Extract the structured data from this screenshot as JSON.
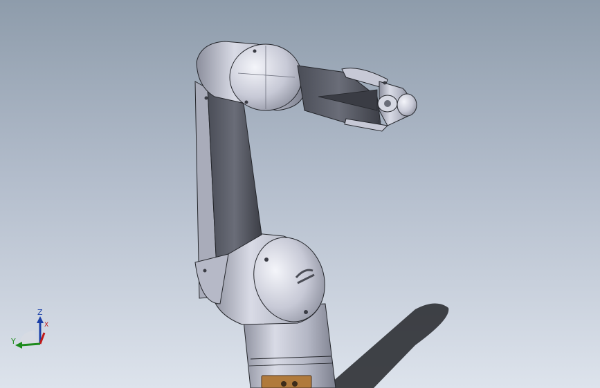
{
  "viewport": {
    "background_top": "#8e9cab",
    "background_bottom": "#dde3ec"
  },
  "model": {
    "name": "robot-arm",
    "color_body": "#b9bccb",
    "color_shadow": "#2f3136",
    "color_edge": "#24262b",
    "base_badge_color": "#b07a3c"
  },
  "triad": {
    "z_label": "Z",
    "x_label": "X",
    "y_label": "Y",
    "z_color": "#1a3fa8",
    "x_color": "#c01818",
    "y_color": "#1c8a1c"
  }
}
